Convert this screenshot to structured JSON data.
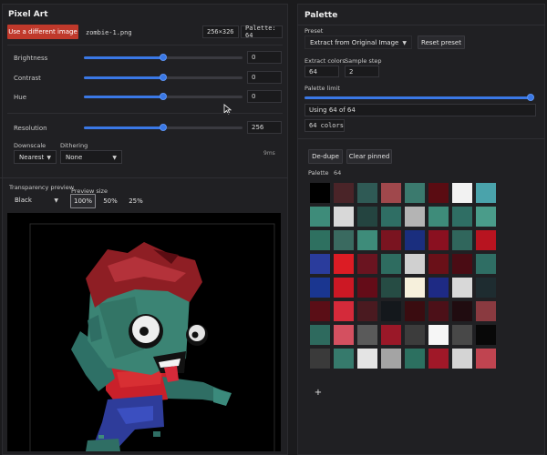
{
  "left": {
    "title": "Pixel Art",
    "change_image_label": "Use a different image",
    "filename": "zombie-1.png",
    "dimensions": "256×326",
    "palette_badge": "Palette: 64",
    "adjust": [
      {
        "label": "Brightness",
        "value": "0",
        "fraction": 0.5
      },
      {
        "label": "Contrast",
        "value": "0",
        "fraction": 0.5
      },
      {
        "label": "Hue",
        "value": "0",
        "fraction": 0.5
      },
      {
        "label": "Resolution",
        "value": "256",
        "fraction": 0.5
      }
    ],
    "downscale_label": "Downscale",
    "downscale_value": "Nearest",
    "dithering_label": "Dithering",
    "dithering_value": "None",
    "timing": "9ms",
    "transparency_label": "Transparency preview",
    "transparency_value": "Black",
    "preview_size_label": "Preview size",
    "preview_sizes": [
      "100%",
      "50%",
      "25%"
    ],
    "preview_size_selected": "100%"
  },
  "right": {
    "title": "Palette",
    "preset_label": "Preset",
    "preset_value": "Extract from Original Image",
    "reset_label": "Reset preset",
    "extract_label": "Extract colors",
    "extract_value": "64",
    "step_label": "Sample step",
    "step_value": "2",
    "limit_label": "Palette limit",
    "limit_fraction": 1.0,
    "using_text": "Using 64 of 64",
    "colors_text": "64 colors",
    "dedupe_label": "De-dupe",
    "clear_label": "Clear pinned",
    "palette_label": "Palette",
    "palette_count": "64",
    "add_label": "+",
    "swatches": [
      "#000000",
      "#4a2428",
      "#2f5a55",
      "#a0484c",
      "#3b7a6e",
      "#5a0c12",
      "#f2f2f2",
      "#4aa3ab",
      "#3e8c7a",
      "#d8d8d8",
      "#244440",
      "#2f6e64",
      "#b4b4b4",
      "#3e8c7a",
      "#2f6e64",
      "#4a9c8a",
      "#2e7060",
      "#3a6a60",
      "#3e8c7a",
      "#7a1420",
      "#1a2e7e",
      "#8a1020",
      "#30665c",
      "#b81420",
      "#2a3c9c",
      "#dc1c24",
      "#6a1420",
      "#2e6c60",
      "#d0d0d0",
      "#6a1018",
      "#4a0c14",
      "#2f6e64",
      "#1a3690",
      "#cc1824",
      "#640c18",
      "#264c44",
      "#f6f0dc",
      "#1e2a84",
      "#d8d8d8",
      "#1e2c30",
      "#5a0e16",
      "#d42a3a",
      "#4a1a20",
      "#14181c",
      "#3a0c10",
      "#4c1018",
      "#200c10",
      "#8a3a40",
      "#2e6a5e",
      "#d45060",
      "#5a5a5a",
      "#9a1828",
      "#3c3c3c",
      "#f6f6f6",
      "#484848",
      "#080808",
      "#3a3a3a",
      "#367a6c",
      "#e4e4e4",
      "#a4a4a4",
      "#2c7060",
      "#a01828",
      "#d4d4d4",
      "#c04450"
    ]
  }
}
